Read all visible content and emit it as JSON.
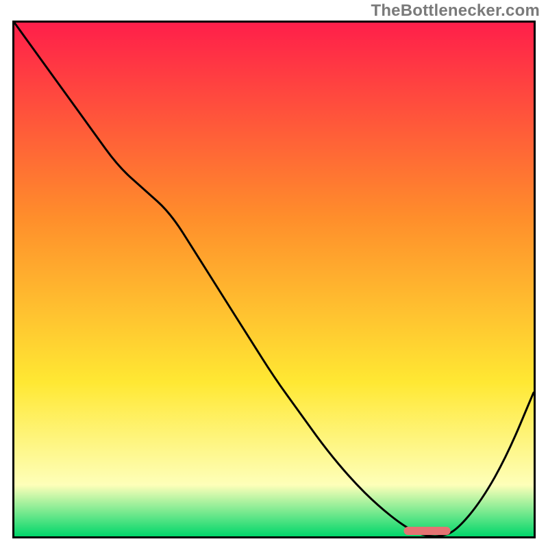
{
  "watermark": "TheBottlenecker.com",
  "colors": {
    "gradient_top": "#ff1f4a",
    "gradient_orange": "#ff8e2b",
    "gradient_yellow": "#ffe833",
    "gradient_pale": "#feffb9",
    "gradient_green": "#00d66a",
    "curve": "#000000",
    "highlight": "#e57373",
    "frame": "#000000"
  },
  "chart_data": {
    "type": "line",
    "title": "",
    "xlabel": "",
    "ylabel": "",
    "xlim": [
      0,
      100
    ],
    "ylim": [
      0,
      100
    ],
    "x": [
      0,
      5,
      10,
      15,
      20,
      25,
      30,
      35,
      40,
      45,
      50,
      55,
      60,
      65,
      70,
      75,
      78,
      80,
      82,
      85,
      90,
      95,
      100
    ],
    "values": [
      100,
      93,
      86,
      79,
      72,
      67.5,
      63,
      55,
      47,
      39,
      31,
      24,
      17,
      11,
      6,
      2,
      0.5,
      0,
      0,
      1,
      7,
      16,
      28
    ],
    "highlight_range_x": [
      75,
      84
    ],
    "curve_description": "Bottleneck-style curve: steep decrease from top-left, minimum near x≈80, then rises toward right.",
    "annotations": []
  }
}
